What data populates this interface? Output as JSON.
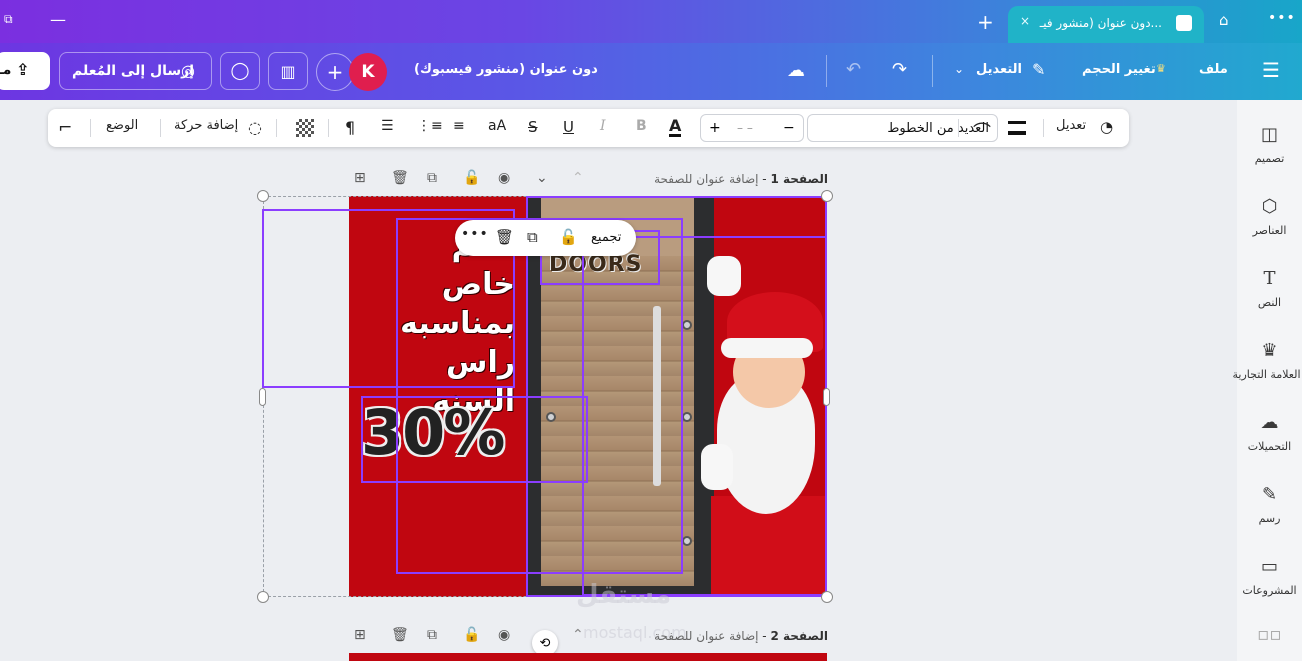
{
  "tabbar": {
    "tab_title": "دون عنوان (منشور فيـ...",
    "new_tab": "+",
    "close": "×",
    "menu": "•••",
    "minimize": "—"
  },
  "header": {
    "share_label": "مـ",
    "send_label": "إرسال إلى المُعلم",
    "avatar_initial": "K",
    "plus": "+",
    "doc_title": "دون عنوان (منشور فيسبوك)",
    "edit_label": "التعديل",
    "resize_label": "تغيير الحجم",
    "file_label": "ملف"
  },
  "toolbar": {
    "position_label": "الوضع",
    "animate_label": "إضافة حركة",
    "case_label": "aA",
    "bold": "B",
    "italic": "I",
    "underline": "U",
    "strike": "S",
    "text_color": "A",
    "plus": "+",
    "minus": "−",
    "size_value": "– –",
    "font_name": "العديد من الخطوط",
    "edit_label": "تعديل"
  },
  "sidebar": {
    "items": [
      {
        "label": "تصميم"
      },
      {
        "label": "العناصر"
      },
      {
        "label": "النص"
      },
      {
        "label": "العلامة التجارية"
      },
      {
        "label": "التحميلات"
      },
      {
        "label": "رسم"
      },
      {
        "label": "المشروعات"
      }
    ]
  },
  "pages": [
    {
      "label": "الصفحة 1",
      "title_hint": "إضافة عنوان للصفحة"
    },
    {
      "label": "الصفحة 2",
      "title_hint": "إضافة عنوان للصفحة"
    }
  ],
  "canvas": {
    "promo_lines": "ـصم\nخاص\nبمناسبه\nراس السنه",
    "percent": "30%",
    "logo": "DOORS",
    "colors": {
      "background": "#c00610",
      "selection": "#8b3dff"
    }
  },
  "context_menu": {
    "group_label": "تجميع",
    "more": "•••"
  },
  "watermark": {
    "line1": "مستقل",
    "line2": "mostaql.com"
  }
}
